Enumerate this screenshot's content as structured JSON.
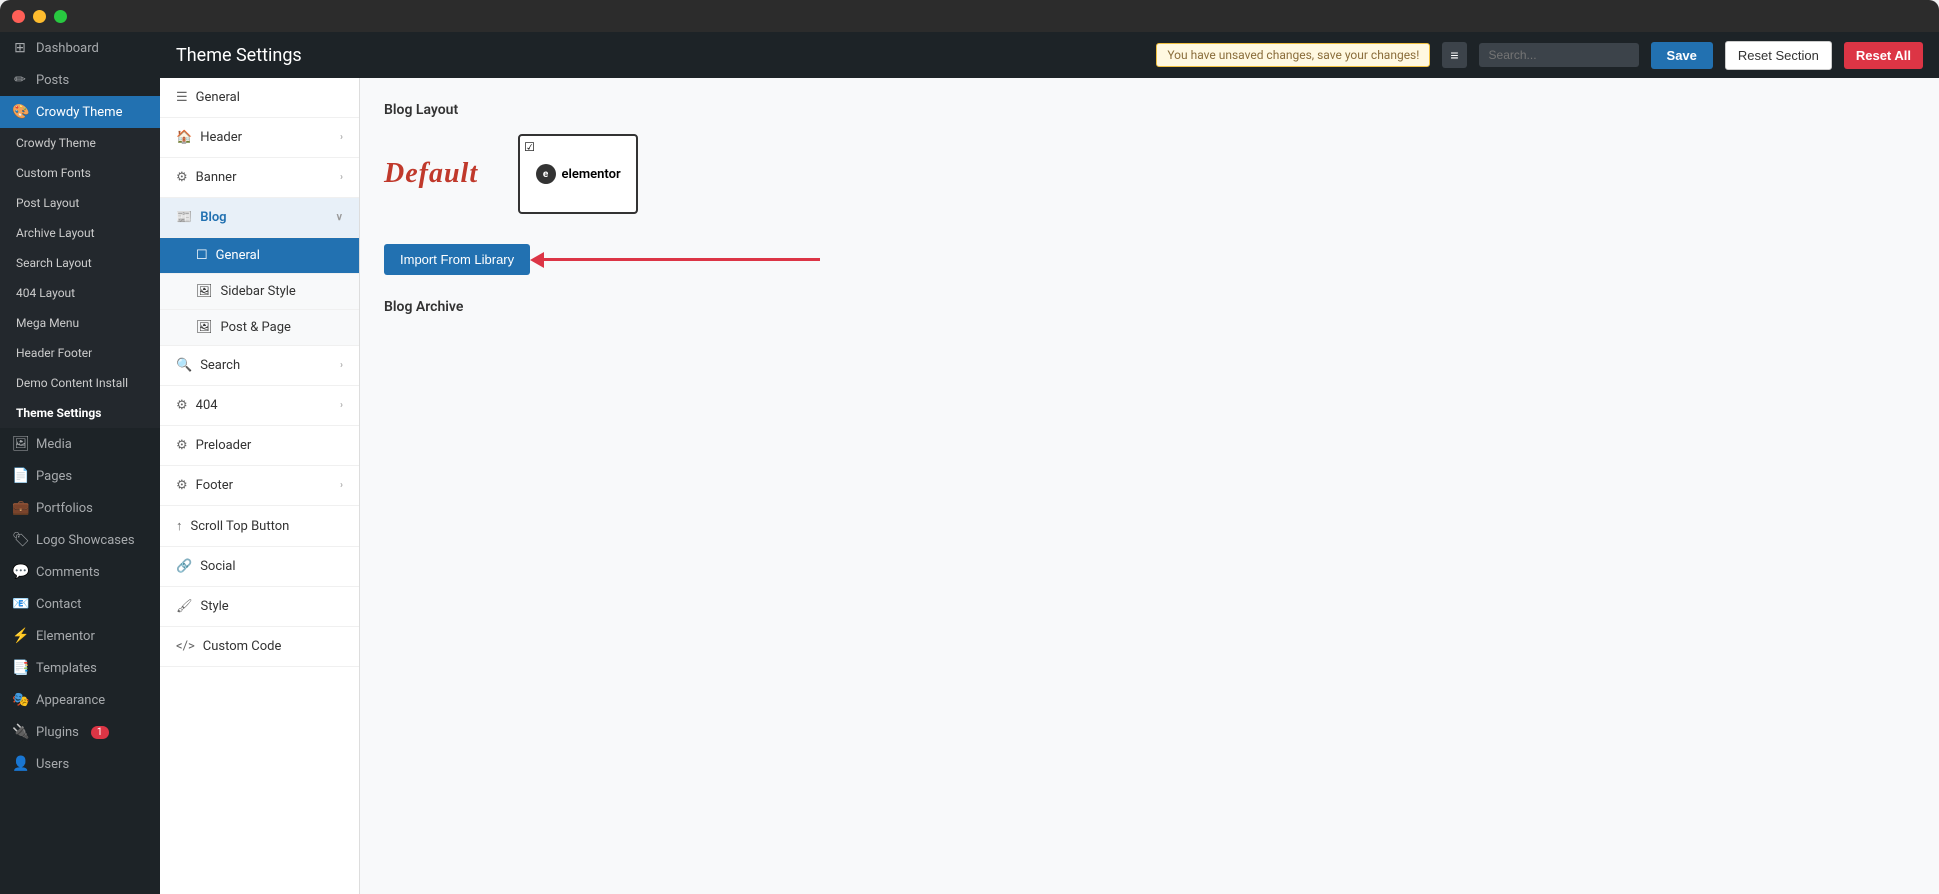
{
  "window": {
    "buttons": {
      "red": "close",
      "yellow": "minimize",
      "green": "maximize"
    }
  },
  "topbar": {
    "title": "Theme Settings",
    "unsaved_message": "You have unsaved changes, save your changes!",
    "search_placeholder": "Search...",
    "save_label": "Save",
    "reset_section_label": "Reset Section",
    "reset_all_label": "Reset All"
  },
  "sidebar": {
    "items": [
      {
        "id": "dashboard",
        "label": "Dashboard",
        "icon": "⊞"
      },
      {
        "id": "posts",
        "label": "Posts",
        "icon": "📝"
      },
      {
        "id": "crowdy-theme",
        "label": "Crowdy Theme",
        "icon": "🎨",
        "active": true
      },
      {
        "id": "media",
        "label": "Media",
        "icon": "🖼"
      },
      {
        "id": "pages",
        "label": "Pages",
        "icon": "📄"
      },
      {
        "id": "portfolios",
        "label": "Portfolios",
        "icon": "💼"
      },
      {
        "id": "logo-showcases",
        "label": "Logo Showcases",
        "icon": "🏷"
      },
      {
        "id": "comments",
        "label": "Comments",
        "icon": "💬"
      },
      {
        "id": "contact",
        "label": "Contact",
        "icon": "📧"
      },
      {
        "id": "elementor",
        "label": "Elementor",
        "icon": "⚡"
      },
      {
        "id": "templates",
        "label": "Templates",
        "icon": "📑"
      },
      {
        "id": "appearance",
        "label": "Appearance",
        "icon": "🎭"
      },
      {
        "id": "plugins",
        "label": "Plugins",
        "icon": "🔌",
        "badge": "1"
      },
      {
        "id": "users",
        "label": "Users",
        "icon": "👤"
      }
    ],
    "submenu": [
      {
        "id": "crowdy-theme-sub",
        "label": "Crowdy Theme"
      },
      {
        "id": "custom-fonts",
        "label": "Custom Fonts"
      },
      {
        "id": "post-layout",
        "label": "Post Layout"
      },
      {
        "id": "archive-layout",
        "label": "Archive Layout"
      },
      {
        "id": "search-layout",
        "label": "Search Layout"
      },
      {
        "id": "404-layout",
        "label": "404 Layout"
      },
      {
        "id": "mega-menu",
        "label": "Mega Menu"
      },
      {
        "id": "header-footer",
        "label": "Header Footer"
      },
      {
        "id": "demo-content-install",
        "label": "Demo Content Install"
      },
      {
        "id": "theme-settings",
        "label": "Theme Settings",
        "active": true
      }
    ]
  },
  "middle_panel": {
    "items": [
      {
        "id": "general",
        "label": "General",
        "icon": "☰",
        "has_arrow": false
      },
      {
        "id": "header",
        "label": "Header",
        "icon": "🏠",
        "has_arrow": true
      },
      {
        "id": "banner",
        "label": "Banner",
        "icon": "⚙",
        "has_arrow": true
      },
      {
        "id": "blog",
        "label": "Blog",
        "icon": "📰",
        "has_arrow": true,
        "active": true,
        "expanded": true
      },
      {
        "id": "blog-general",
        "label": "General",
        "icon": "☐",
        "is_sub": true,
        "active": true
      },
      {
        "id": "sidebar-style",
        "label": "Sidebar Style",
        "icon": "🖼",
        "is_sub": true
      },
      {
        "id": "post-page",
        "label": "Post & Page",
        "icon": "🖼",
        "is_sub": true
      },
      {
        "id": "search",
        "label": "Search",
        "icon": "🔍",
        "has_arrow": true
      },
      {
        "id": "404",
        "label": "404",
        "icon": "⚙",
        "has_arrow": true
      },
      {
        "id": "preloader",
        "label": "Preloader",
        "icon": "⚙"
      },
      {
        "id": "footer",
        "label": "Footer",
        "icon": "⚙",
        "has_arrow": true
      },
      {
        "id": "scroll-top-button",
        "label": "Scroll Top Button",
        "icon": "↑"
      },
      {
        "id": "social",
        "label": "Social",
        "icon": "🔗"
      },
      {
        "id": "style",
        "label": "Style",
        "icon": "🖌"
      },
      {
        "id": "custom-code",
        "label": "Custom Code",
        "icon": "</>"
      }
    ]
  },
  "main": {
    "blog_layout_label": "Blog Layout",
    "default_label": "Default",
    "elementor_logo_text": "elementor",
    "import_button_label": "Import From Library",
    "blog_archive_label": "Blog Archive"
  }
}
